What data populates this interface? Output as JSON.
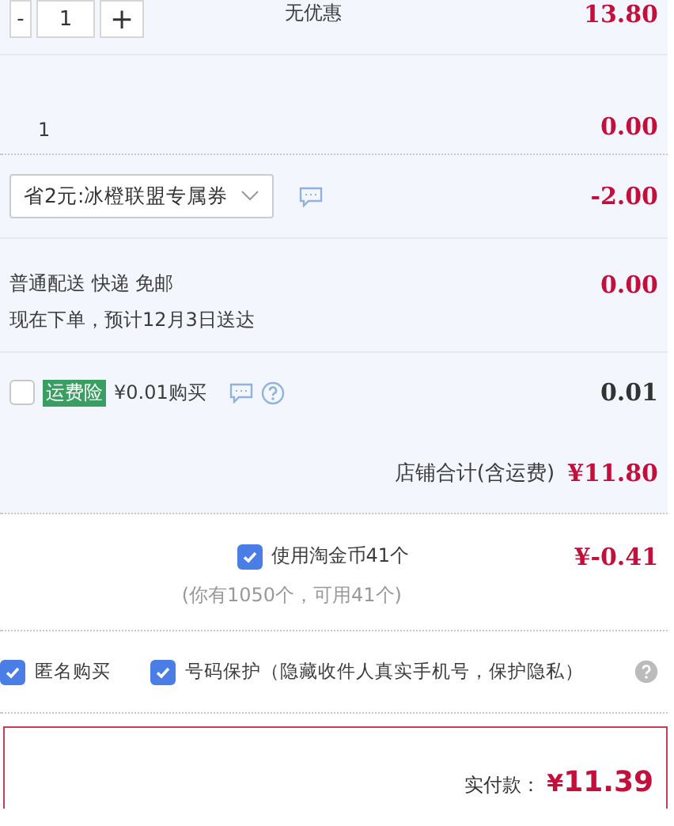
{
  "item": {
    "quantity": "1",
    "minus": "-",
    "plus": "+",
    "promo": "无优惠",
    "price": "13.80"
  },
  "sub_row": {
    "quantity": "1",
    "price": "0.00"
  },
  "coupon": {
    "value": "省2元:冰橙联盟专属券",
    "amount": "-2.00"
  },
  "delivery": {
    "line_1": "普通配送 快递 免邮",
    "line_2": "现在下单，预计12月3日送达",
    "amount": "0.00"
  },
  "insurance": {
    "checked": false,
    "tag": "运费险",
    "label": "¥0.01购买",
    "amount": "0.01"
  },
  "shop_total": {
    "label": "店铺合计(含运费)",
    "amount": "¥11.80"
  },
  "coins": {
    "checked": true,
    "label": "使用淘金币41个",
    "note": "(你有1050个，可用41个)",
    "amount": "¥-0.41"
  },
  "options": [
    {
      "label": "匿名购买",
      "checked": true
    },
    {
      "label": "号码保护（隐藏收件人真实手机号，保护隐私）",
      "checked": true
    }
  ],
  "payment": {
    "label": "实付款：",
    "currency": "¥",
    "amount": "11.39"
  }
}
